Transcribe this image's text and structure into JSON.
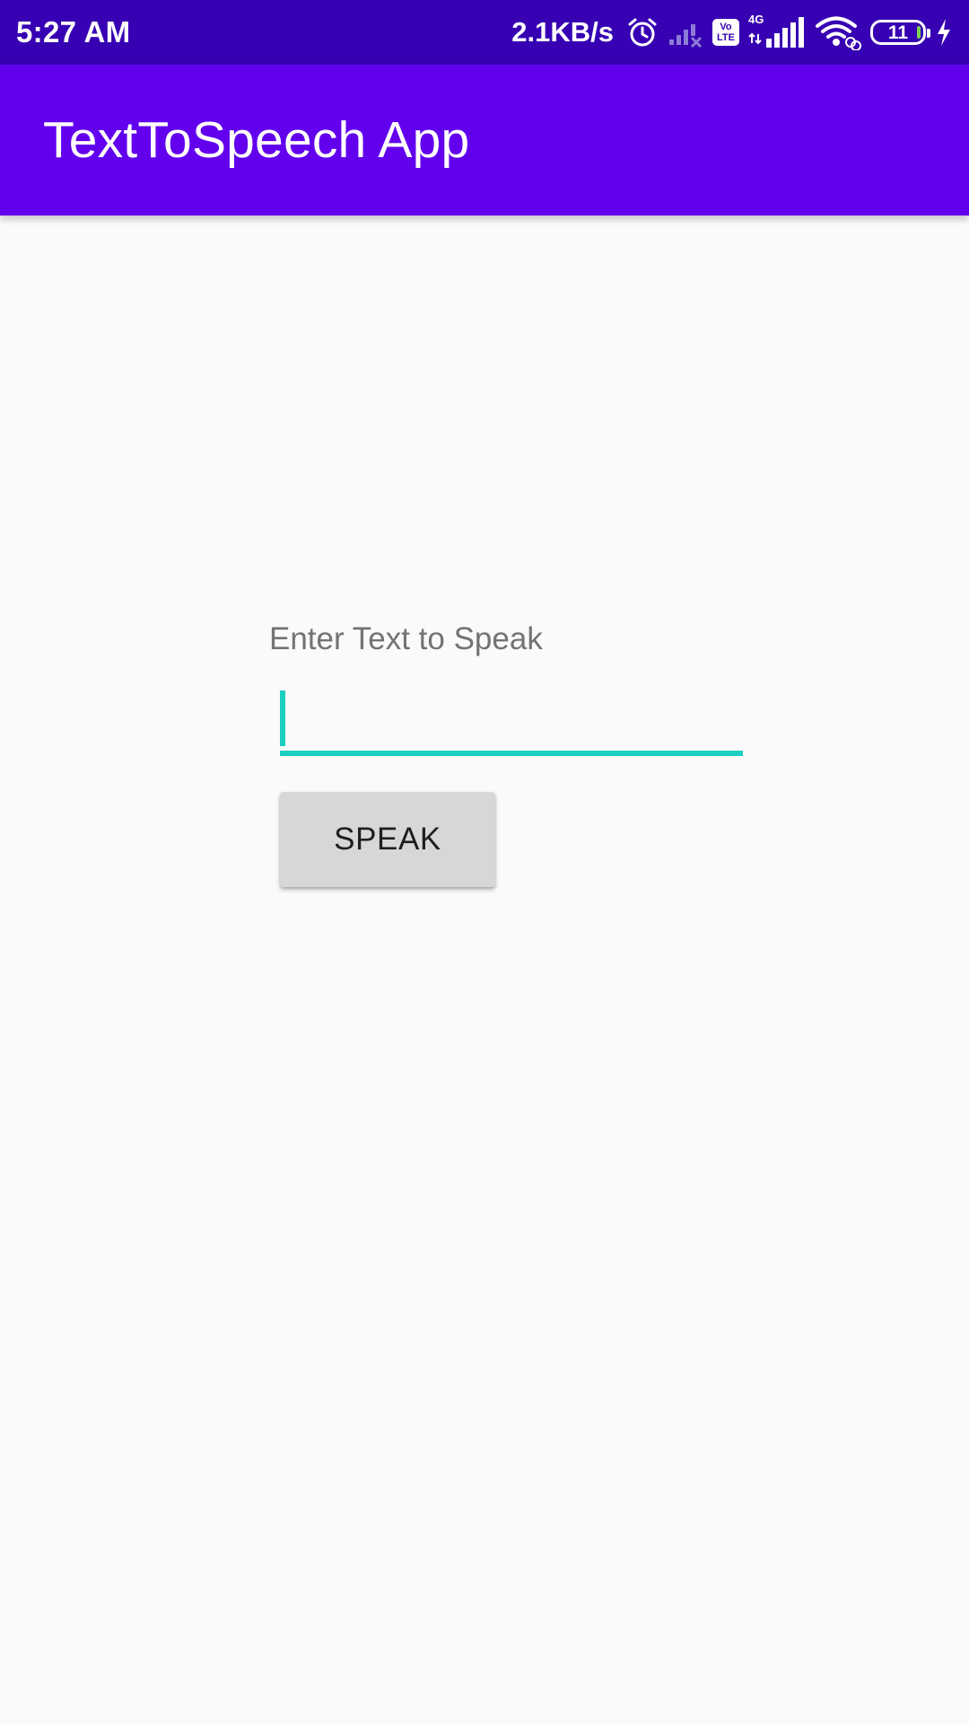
{
  "status_bar": {
    "time": "5:27 AM",
    "network_speed": "2.1KB/s",
    "volte_label_top": "Vo",
    "volte_label_bottom": "LTE",
    "network_type": "4G",
    "battery_level": "11",
    "icons": [
      "alarm-icon",
      "no-signal-icon",
      "volte-icon",
      "cell-signal-icon",
      "wifi-icon",
      "battery-icon",
      "charging-icon"
    ]
  },
  "app_bar": {
    "title": "TextToSpeech App",
    "color": "#6200ee"
  },
  "main": {
    "prompt_label": "Enter Text to Speak",
    "input_value": "",
    "speak_button_label": "SPEAK"
  },
  "colors": {
    "status_bar": "#3700b3",
    "accent": "#1ccfc0",
    "background": "#fafafa"
  }
}
